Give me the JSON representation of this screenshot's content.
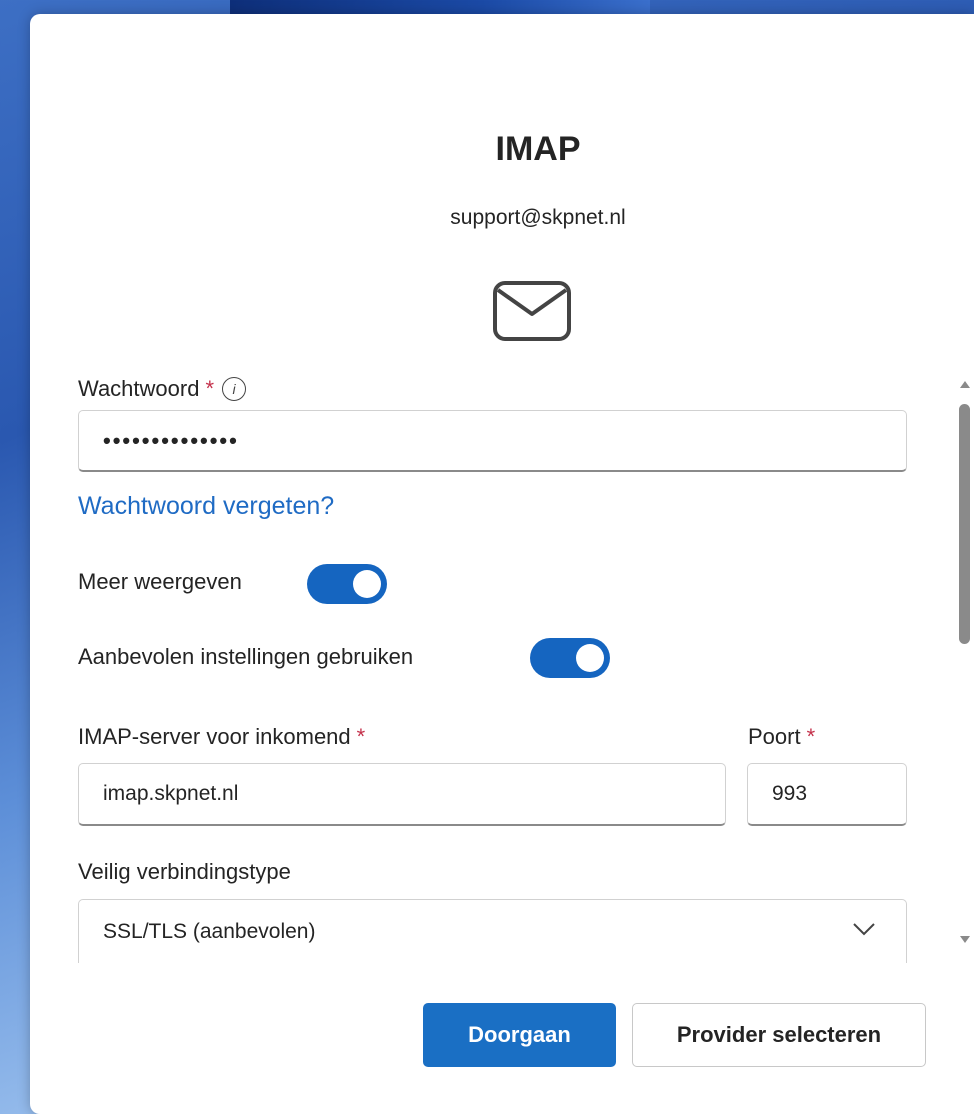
{
  "dialog": {
    "title": "IMAP",
    "email": "support@skpnet.nl"
  },
  "icons": {
    "mail": "mail-envelope-icon",
    "info": "info-icon",
    "chevron": "chevron-down-icon"
  },
  "form": {
    "password": {
      "label": "Wachtwoord",
      "required_mark": "*",
      "info_glyph": "i",
      "value": "••••••••••••••"
    },
    "forgot_password_link": "Wachtwoord vergeten?",
    "show_more": {
      "label": "Meer weergeven",
      "on": true
    },
    "recommended_settings": {
      "label": "Aanbevolen instellingen gebruiken",
      "on": true
    },
    "imap_server": {
      "label": "IMAP-server voor inkomend",
      "required_mark": "*",
      "value": "imap.skpnet.nl"
    },
    "port": {
      "label": "Poort",
      "required_mark": "*",
      "value": "993"
    },
    "connection_type": {
      "label": "Veilig verbindingstype",
      "value": "SSL/TLS (aanbevolen)"
    }
  },
  "buttons": {
    "continue": "Doorgaan",
    "select_provider": "Provider selecteren"
  },
  "colors": {
    "accent": "#1a6fc4",
    "link": "#1f6bc4",
    "required": "#c4314b",
    "toggle_on": "#1565c0"
  }
}
